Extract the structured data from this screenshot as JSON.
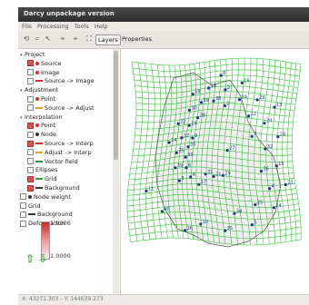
{
  "app": {
    "title": "Darcy unpackage version"
  },
  "menu": [
    "File",
    "Processing",
    "Tools",
    "Help"
  ],
  "tabs": {
    "layers": "Layers",
    "properties": "Properties"
  },
  "layers": [
    {
      "label": "Project",
      "indent": 0,
      "type": "group"
    },
    {
      "label": "Source",
      "indent": 1,
      "type": "checked-dot",
      "color": "#d32f2f"
    },
    {
      "label": "Image",
      "indent": 1,
      "type": "dot",
      "color": "#d32f2f"
    },
    {
      "label": "Source -> Image",
      "indent": 1,
      "type": "line",
      "color": "#d32f2f"
    },
    {
      "label": "Adjustment",
      "indent": 0,
      "type": "group"
    },
    {
      "label": "Point",
      "indent": 1,
      "type": "dot",
      "color": "#d32f2f"
    },
    {
      "label": "Source -> Adjust",
      "indent": 1,
      "type": "line",
      "color": "#e8a317"
    },
    {
      "label": "Interpolation",
      "indent": 0,
      "type": "group"
    },
    {
      "label": "Point",
      "indent": 1,
      "type": "checked-dot",
      "color": "#d32f2f"
    },
    {
      "label": "Node",
      "indent": 1,
      "type": "dot",
      "color": "#333333"
    },
    {
      "label": "Source -> Interp",
      "indent": 1,
      "type": "checked-line",
      "color": "#d32f2f"
    },
    {
      "label": "Adjust -> Interp",
      "indent": 1,
      "type": "line",
      "color": "#e8a317"
    },
    {
      "label": "Vector field",
      "indent": 1,
      "type": "line",
      "color": "#2e9e2e"
    },
    {
      "label": "Ellipses",
      "indent": 1,
      "type": "box"
    },
    {
      "label": "Grid",
      "indent": 1,
      "type": "checked-line",
      "color": "#2e9e2e"
    },
    {
      "label": "Background",
      "indent": 1,
      "type": "checked-line",
      "color": "#333333"
    },
    {
      "label": "Node weight",
      "indent": 0,
      "type": "dot",
      "color": "#333333"
    },
    {
      "label": "Grid",
      "indent": 0,
      "type": "box"
    },
    {
      "label": "Background",
      "indent": 0,
      "type": "line",
      "color": "#333333"
    },
    {
      "label": "Deformation",
      "indent": 0,
      "type": "box"
    }
  ],
  "deformation": {
    "max": "1.9306",
    "min": "1.0000"
  },
  "status": {
    "coords": "X: 43271.303 - Y: 144639.273"
  },
  "map_labels": [
    "27",
    "3",
    "8",
    "29",
    "14",
    "13",
    "17",
    "19",
    "23",
    "39",
    "16",
    "21",
    "22",
    "24",
    "4",
    "18",
    "24",
    "35",
    "29",
    "31",
    "30",
    "15",
    "6",
    "2",
    "5",
    "37",
    "20",
    "26",
    "39",
    "4",
    "33",
    "34",
    "35",
    "19",
    "32",
    "40",
    "36",
    "25",
    "35",
    "12",
    "10",
    "28",
    "36",
    "11",
    "1",
    "38",
    "9",
    "7"
  ]
}
